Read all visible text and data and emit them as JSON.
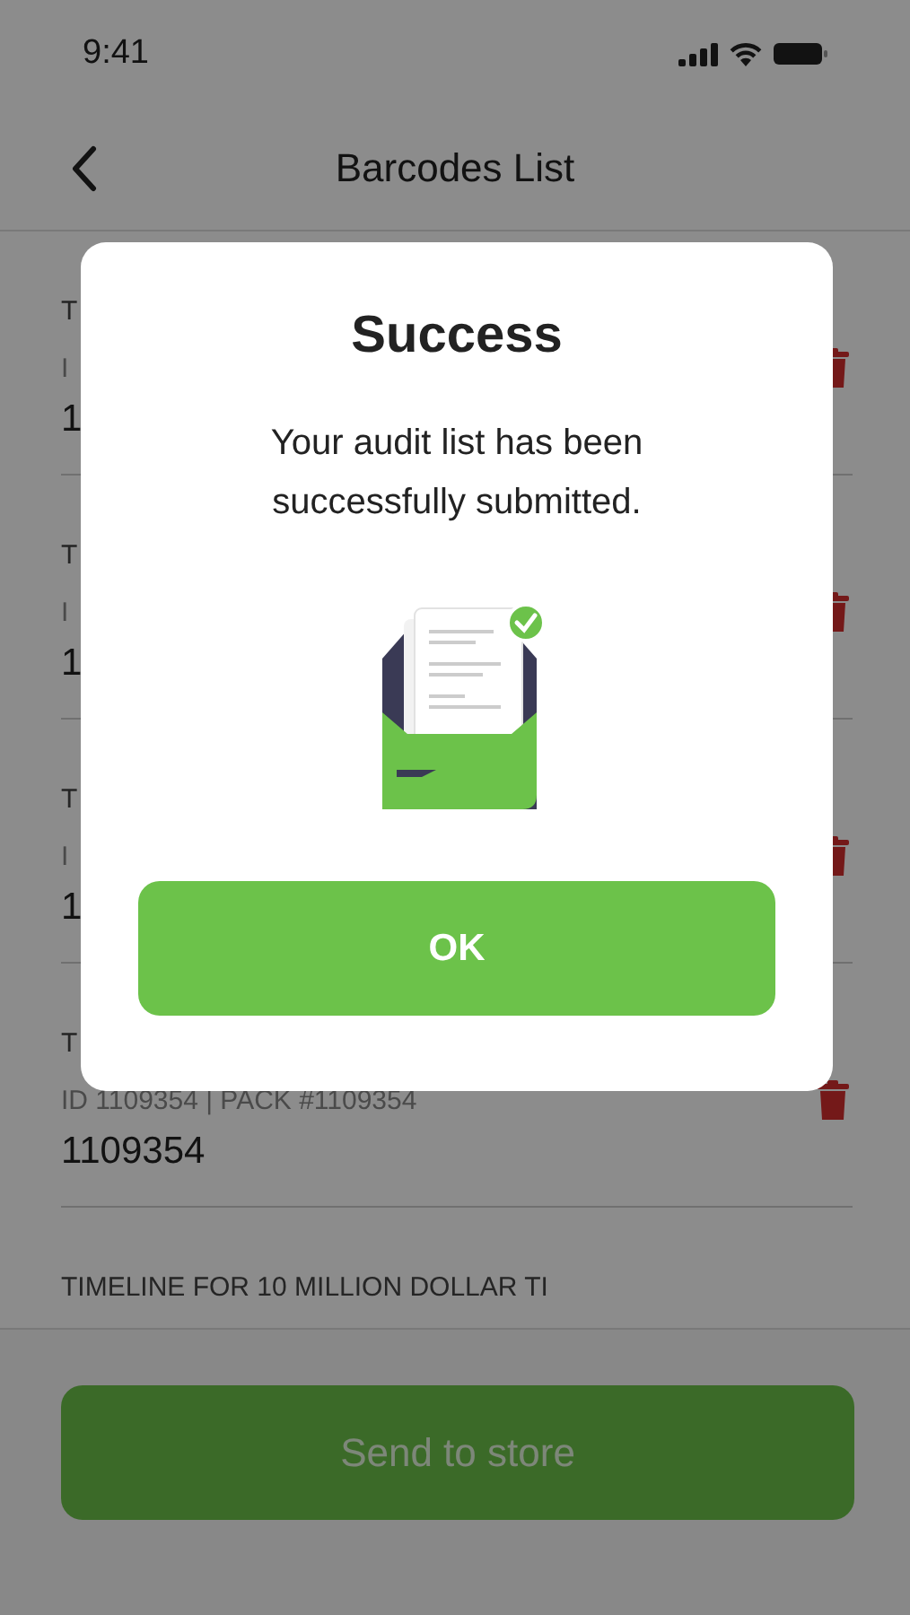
{
  "status_bar": {
    "time": "9:41"
  },
  "nav": {
    "title": "Barcodes List"
  },
  "rows": [
    {
      "title": "T",
      "id_line": "I",
      "number": "1"
    },
    {
      "title": "T",
      "id_line": "I",
      "number": "1"
    },
    {
      "title": "T",
      "id_line": "I",
      "number": "1"
    },
    {
      "title": "T",
      "id_line": "ID 1109354 | PACK #1109354",
      "number": "1109354"
    },
    {
      "title": "TIMELINE FOR 10 MILLION DOLLAR TI"
    }
  ],
  "footer": {
    "button": "Send to store"
  },
  "dialog": {
    "title": "Success",
    "message": "Your audit list has been successfully submitted.",
    "button": "OK"
  }
}
